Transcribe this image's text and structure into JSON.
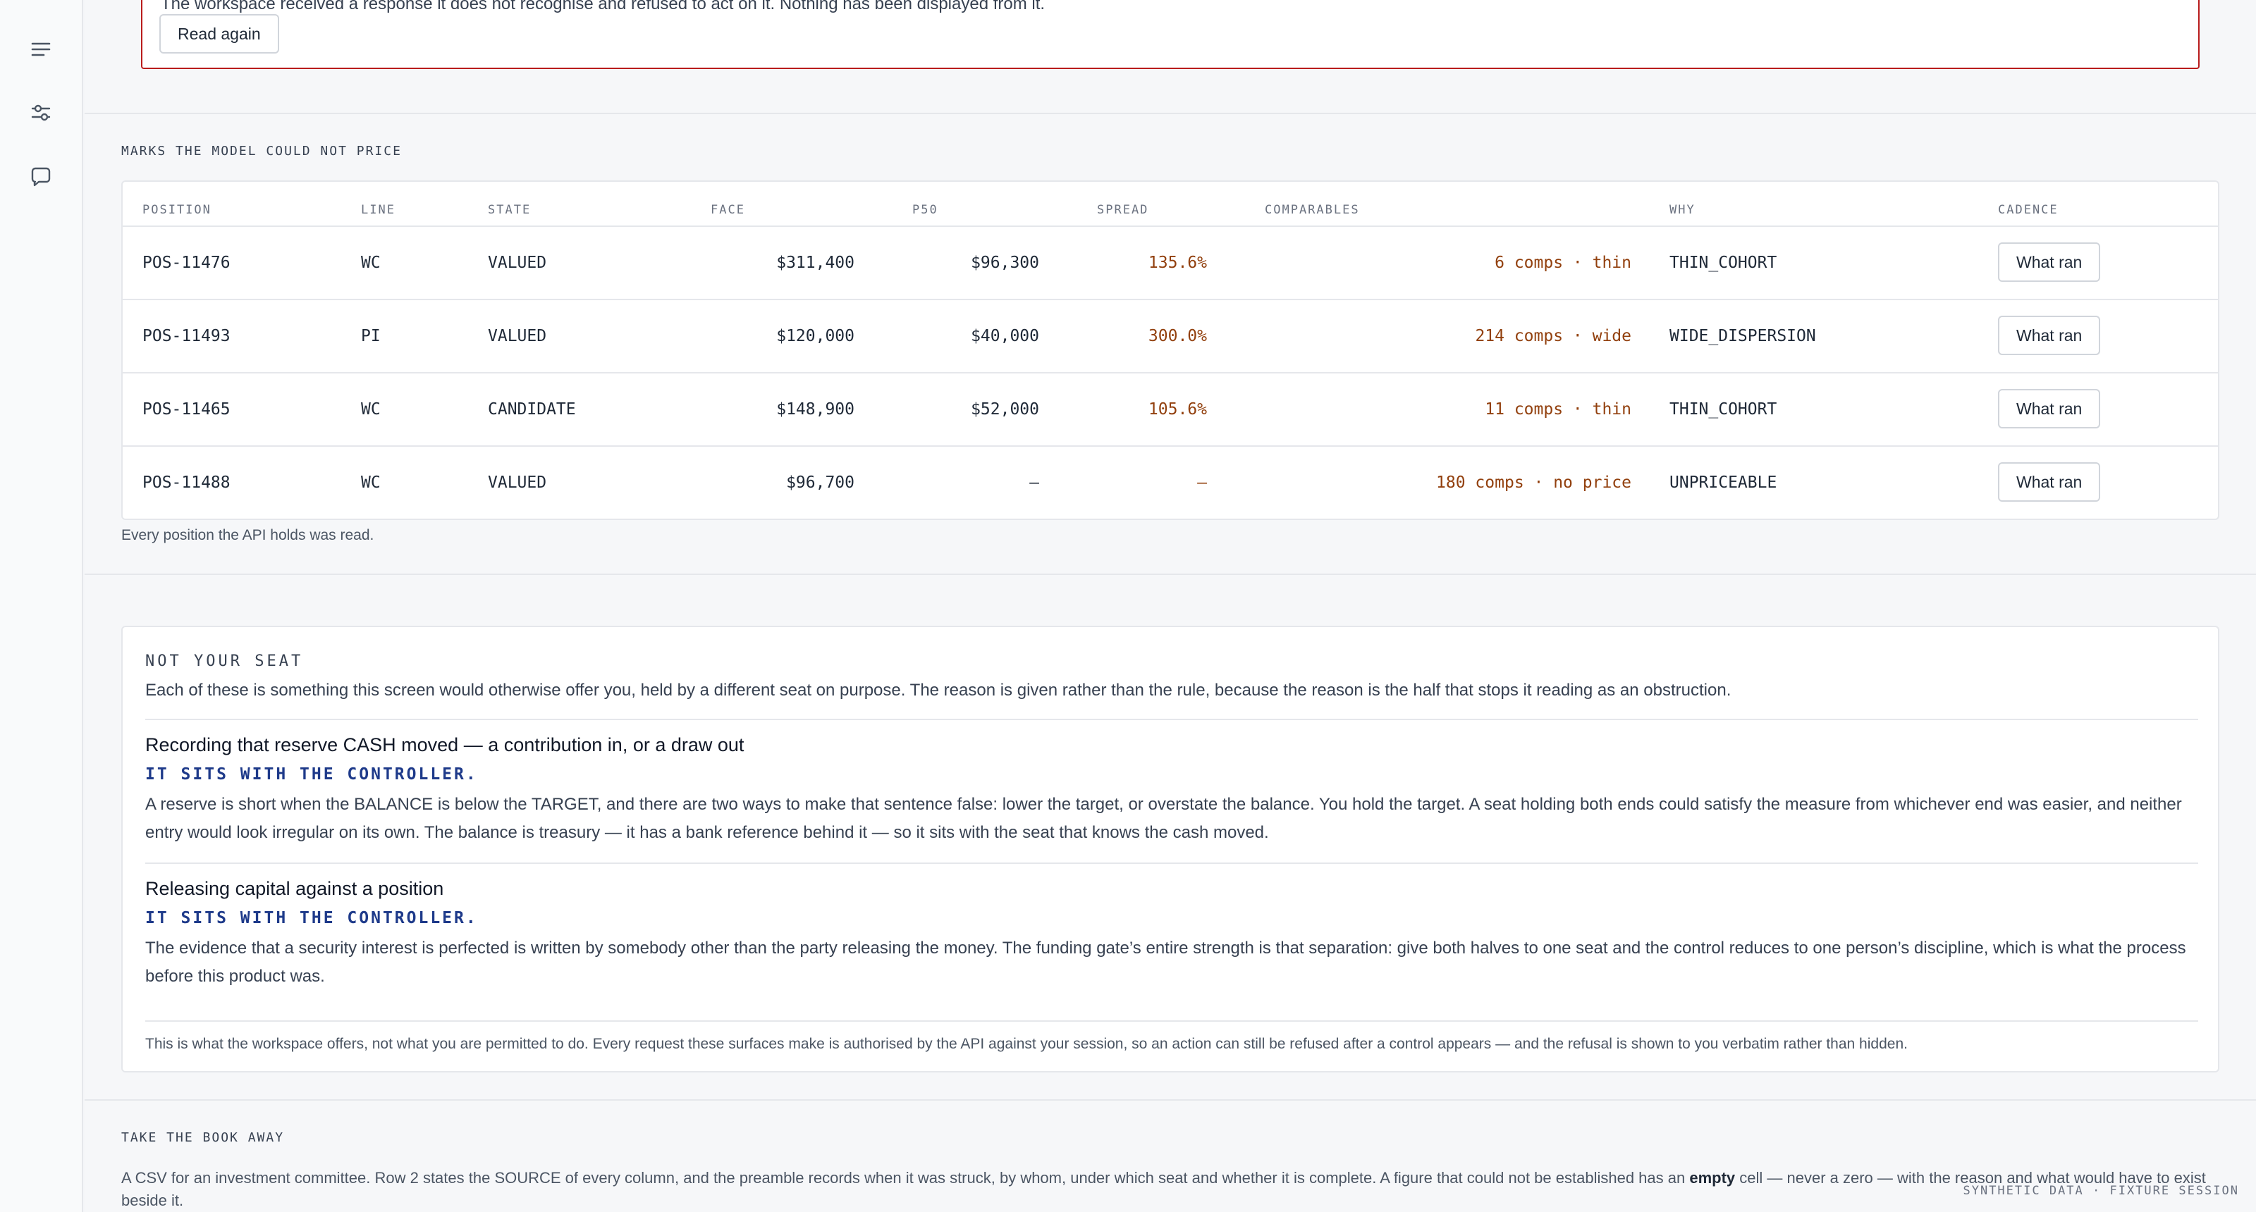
{
  "rail": {
    "icons": [
      "menu-icon",
      "sliders-icon",
      "chat-icon"
    ]
  },
  "error_banner": {
    "text": "The workspace received a response it does not recognise and refused to act on it. Nothing has been displayed from it.",
    "button_label": "Read again"
  },
  "marks": {
    "kicker": "MARKS THE MODEL COULD NOT PRICE",
    "columns": [
      "POSITION",
      "LINE",
      "STATE",
      "FACE",
      "P50",
      "SPREAD",
      "COMPARABLES",
      "WHY",
      "CADENCE"
    ],
    "rows": [
      {
        "position": "POS-11476",
        "line": "WC",
        "state": "VALUED",
        "face": "$311,400",
        "p50": "$96,300",
        "spread": "135.6%",
        "comparables": "6 comps · thin",
        "why": "THIN_COHORT",
        "action": "What ran"
      },
      {
        "position": "POS-11493",
        "line": "PI",
        "state": "VALUED",
        "face": "$120,000",
        "p50": "$40,000",
        "spread": "300.0%",
        "comparables": "214 comps · wide",
        "why": "WIDE_DISPERSION",
        "action": "What ran"
      },
      {
        "position": "POS-11465",
        "line": "WC",
        "state": "CANDIDATE",
        "face": "$148,900",
        "p50": "$52,000",
        "spread": "105.6%",
        "comparables": "11 comps · thin",
        "why": "THIN_COHORT",
        "action": "What ran"
      },
      {
        "position": "POS-11488",
        "line": "WC",
        "state": "VALUED",
        "face": "$96,700",
        "p50": "—",
        "spread": "—",
        "comparables": "180 comps · no price",
        "why": "UNPRICEABLE",
        "action": "What ran"
      }
    ],
    "note": "Every position the API holds was read."
  },
  "seat": {
    "kicker": "NOT YOUR SEAT",
    "intro": "Each of these is something this screen would otherwise offer you, held by a different seat on purpose. The reason is given rather than the rule, because the reason is the half that stops it reading as an obstruction.",
    "items": [
      {
        "title": "Recording that reserve CASH moved — a contribution in, or a draw out",
        "sub": "IT SITS WITH THE CONTROLLER.",
        "body": "A reserve is short when the BALANCE is below the TARGET, and there are two ways to make that sentence false: lower the target, or overstate the balance. You hold the target. A seat holding both ends could satisfy the measure from whichever end was easier, and neither entry would look irregular on its own. The balance is treasury — it has a bank reference behind it — so it sits with the seat that knows the cash moved."
      },
      {
        "title": "Releasing capital against a position",
        "sub": "IT SITS WITH THE CONTROLLER.",
        "body": "The evidence that a security interest is perfected is written by somebody other than the party releasing the money. The funding gate’s entire strength is that separation: give both halves to one seat and the control reduces to one person’s discipline, which is what the process before this product was."
      }
    ],
    "footnote": "This is what the workspace offers, not what you are permitted to do. Every request these surfaces make is authorised by the API against your session, so an action can still be refused after a control appears — and the refusal is shown to you verbatim rather than hidden."
  },
  "book": {
    "kicker": "TAKE THE BOOK AWAY",
    "text_before": "A CSV for an investment committee. Row 2 states the SOURCE of every column, and the preamble records when it was struck, by whom, under which seat and whether it is complete. A figure that could not be established has an ",
    "text_bold": "empty",
    "text_after": " cell — never a zero — with the reason and what would have to exist beside it."
  },
  "footer": {
    "label": "SYNTHETIC DATA · FIXTURE SESSION"
  }
}
